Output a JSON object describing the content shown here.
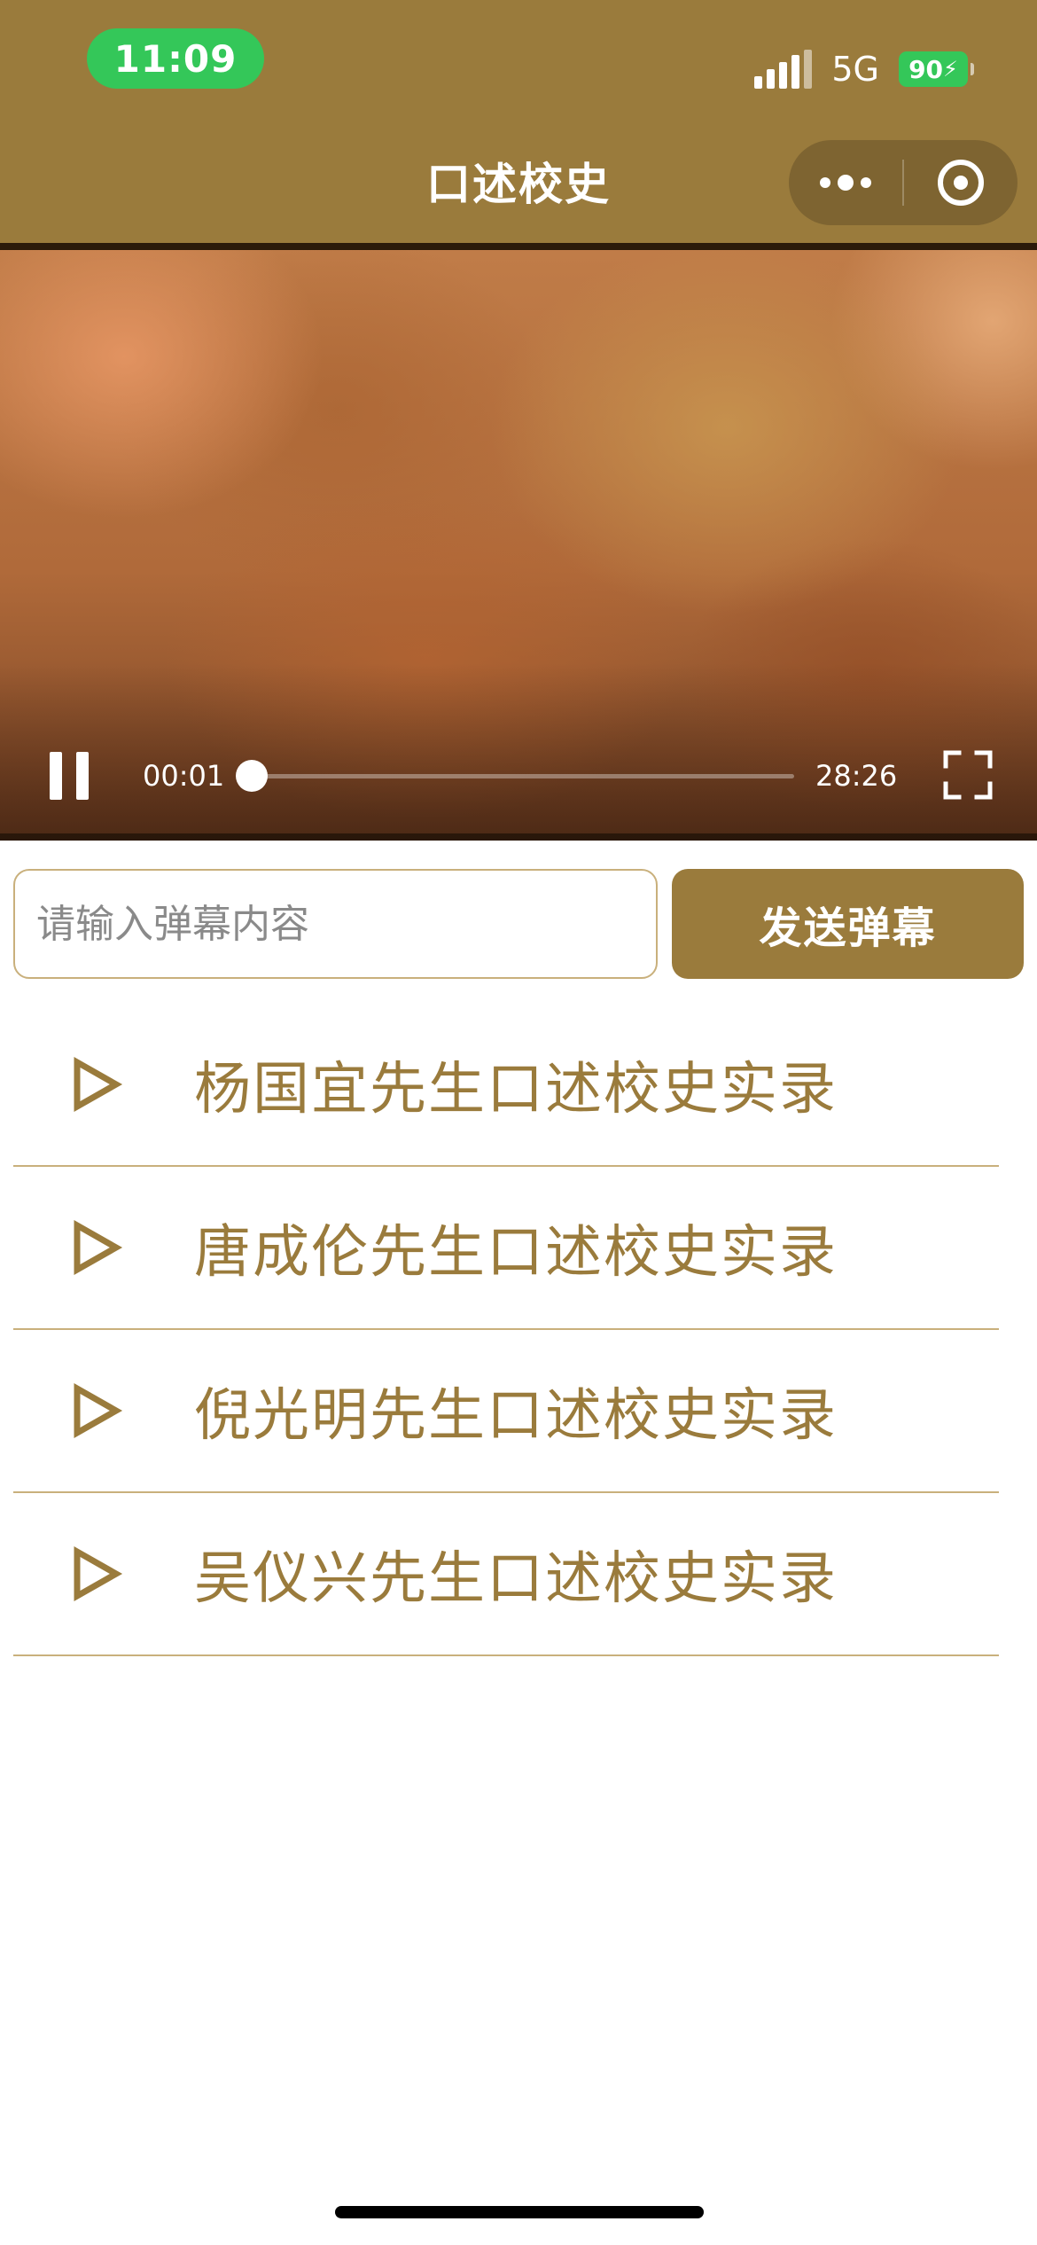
{
  "status_bar": {
    "time": "11:09",
    "network": "5G",
    "battery": "90"
  },
  "nav": {
    "title": "口述校史",
    "more_icon": "more-dots-icon",
    "close_icon": "target-circle-icon"
  },
  "video": {
    "current_time": "00:01",
    "total_time": "28:26",
    "progress": 0.0006,
    "state": "playing",
    "pause_icon": "pause-icon",
    "fullscreen_icon": "fullscreen-icon"
  },
  "danmaku": {
    "placeholder": "请输入弹幕内容",
    "value": "",
    "send_label": "发送弹幕"
  },
  "playlist": {
    "items": [
      {
        "title": "杨国宜先生口述校史实录",
        "icon": "play-triangle-icon"
      },
      {
        "title": "唐成伦先生口述校史实录",
        "icon": "play-triangle-icon"
      },
      {
        "title": "倪光明先生口述校史实录",
        "icon": "play-triangle-icon"
      },
      {
        "title": "吴仪兴先生口述校史实录",
        "icon": "play-triangle-icon"
      }
    ]
  },
  "colors": {
    "brand": "#9A7B3C",
    "time_pill": "#34C759",
    "divider": "#C9B07C"
  }
}
